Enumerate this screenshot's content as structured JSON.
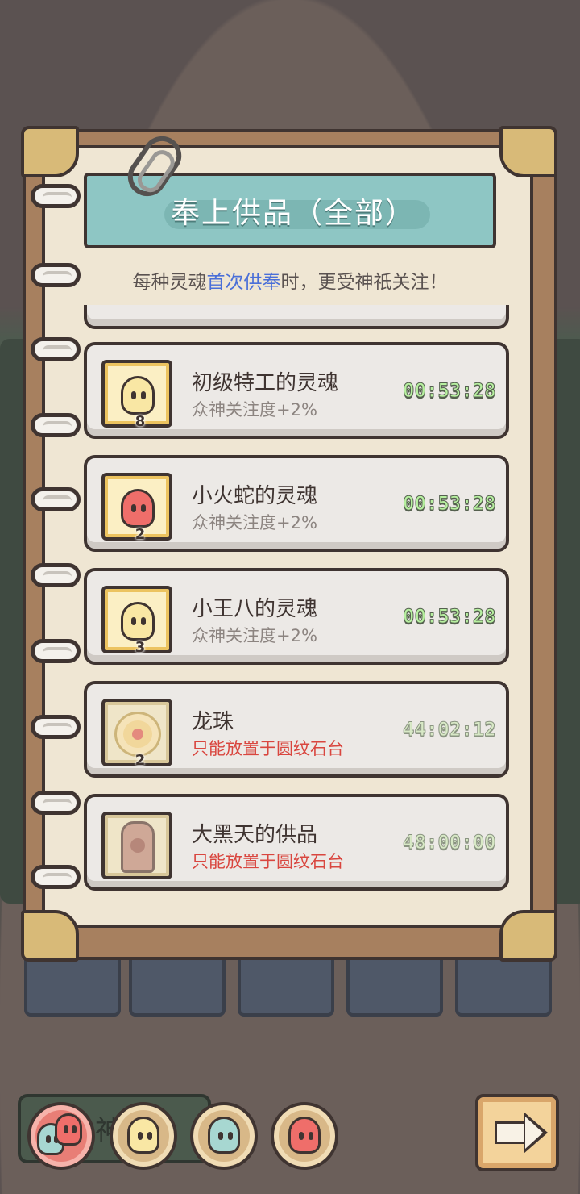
{
  "dialog": {
    "title": "奉上供品（全部）",
    "subtitle_prefix": "每种灵魂",
    "subtitle_highlight": "首次供奉",
    "subtitle_suffix": "时，更受神祇关注！"
  },
  "offerings": [
    {
      "name": "初级特工的灵魂",
      "desc": "众神关注度+2%",
      "count": "8",
      "timer": "00:53:28",
      "icon": "yellow-soul-icon"
    },
    {
      "name": "小火蛇的灵魂",
      "desc": "众神关注度+2%",
      "count": "2",
      "timer": "00:53:28",
      "icon": "red-soul-icon"
    },
    {
      "name": "小王八的灵魂",
      "desc": "众神关注度+2%",
      "count": "3",
      "timer": "00:53:28",
      "icon": "yellow-soul-icon"
    },
    {
      "name": "龙珠",
      "desc": "只能放置于圆纹石台",
      "count": "2",
      "timer": "44:02:12",
      "icon": "dragon-orb-icon"
    },
    {
      "name": "大黑天的供品",
      "desc": "只能放置于圆纹石台",
      "timer": "48:00:00",
      "icon": "statue-icon"
    }
  ],
  "bottom_bar": {
    "tab_label": "神",
    "filters": [
      "all-souls-icon",
      "yellow-soul-icon",
      "teal-soul-icon",
      "red-soul-icon"
    ]
  },
  "colors": {
    "timer_green": "#b7f0a0",
    "highlight_blue": "#4a6fd8",
    "warning_red": "#d9463f",
    "banner_teal": "#8ec6c4"
  }
}
